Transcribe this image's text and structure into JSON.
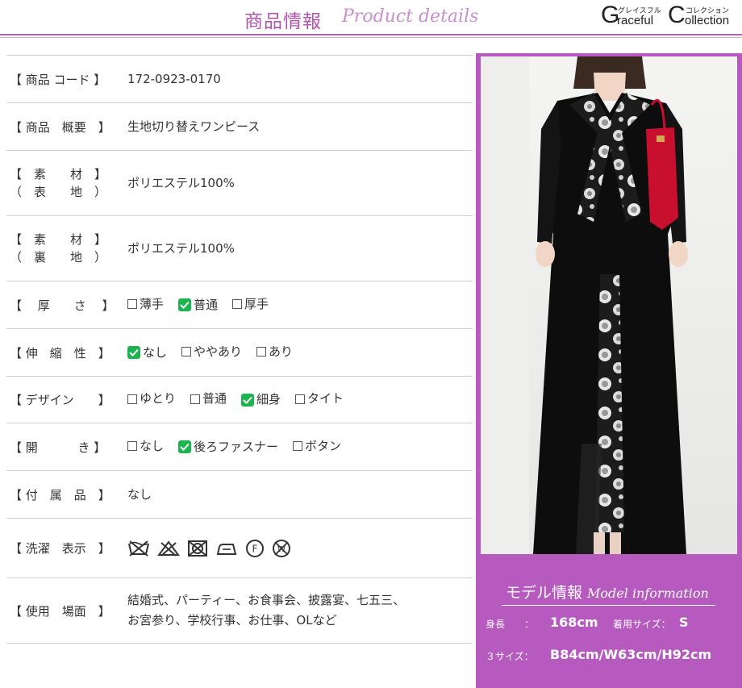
{
  "header": {
    "title_ja": "商品情報",
    "title_en": "Product details",
    "brand_g": "G",
    "brand_raceful": "raceful",
    "brand_c": "C",
    "brand_ollection": "ollection",
    "brand_kana_1": "グレイスフル",
    "brand_kana_2": "コレクション"
  },
  "specs": [
    {
      "label": "【 商品 コード 】",
      "value": "172-0923-0170"
    },
    {
      "label": "【 商品　概要　】",
      "value": "生地切り替えワンピース"
    },
    {
      "label1": "【　素　　材　】",
      "label2": "（　表　　地　）",
      "value": "ポリエステル100%"
    },
    {
      "label1": "【　素　　材　】",
      "label2": "（　裏　　地　）",
      "value": "ポリエステル100%"
    },
    {
      "label": "【　 厚　　さ 　】",
      "options": [
        {
          "text": "薄手",
          "checked": false
        },
        {
          "text": "普通",
          "checked": true
        },
        {
          "text": "厚手",
          "checked": false
        }
      ]
    },
    {
      "label": "【 伸　縮　性　】",
      "options": [
        {
          "text": "なし",
          "checked": true
        },
        {
          "text": "ややあり",
          "checked": false
        },
        {
          "text": "あり",
          "checked": false
        }
      ]
    },
    {
      "label": "【 デザイン　　】",
      "options": [
        {
          "text": "ゆとり",
          "checked": false
        },
        {
          "text": "普通",
          "checked": false
        },
        {
          "text": "細身",
          "checked": true
        },
        {
          "text": "タイト",
          "checked": false
        }
      ]
    },
    {
      "label": "【 開　　　 き 】",
      "options": [
        {
          "text": "なし",
          "checked": false
        },
        {
          "text": "後ろファスナー",
          "checked": true
        },
        {
          "text": "ボタン",
          "checked": false
        }
      ]
    },
    {
      "label": "【 付　属　品　】",
      "value": "なし"
    },
    {
      "label": "【 洗濯　表示　】",
      "care_icons": [
        "no-wash-icon",
        "no-bleach-icon",
        "no-tumble-dry-icon",
        "low-iron-icon",
        "dry-clean-f-icon",
        "no-wet-clean-icon"
      ],
      "care_f": "F",
      "care_w": "W"
    },
    {
      "label": "【 使用　場面　】",
      "value_line1": "結婚式、パーティー、お食事会、披露宴、七五三、",
      "value_line2": "お宮参り、学校行事、お仕事、OLなど"
    }
  ],
  "model": {
    "title_ja": "モデル情報",
    "title_en": "Model information",
    "height_label": "身長　　：",
    "height_value": "168cm",
    "size_label": "着用サイズ：",
    "size_value": "S",
    "three_size_label": "３サイズ：",
    "three_size_value": "B84cm/W63cm/H92cm"
  },
  "colors": {
    "accent": "#b65ac0",
    "check": "#1db34f"
  }
}
